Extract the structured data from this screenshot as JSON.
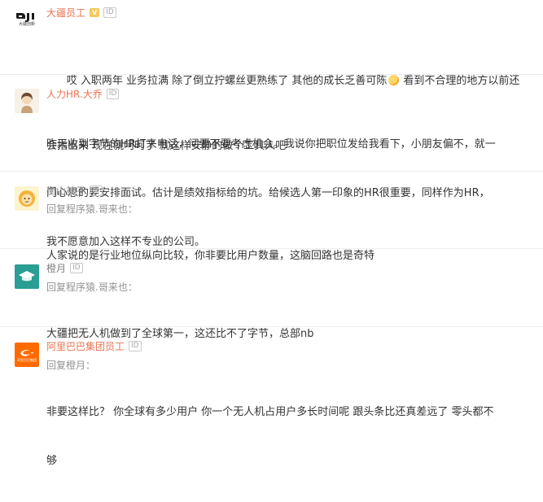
{
  "comments": [
    {
      "username": "大疆员工",
      "badge_v": "V",
      "badge_id": "ID",
      "avatar_text": "大疆创新",
      "lines": [
        "哎 入职两年 业务拉满 除了倒立拧螺丝更熟练了 其他的成长乏善可陈",
        "会指出来 现在就呵呵了 就这样安静的做个工具人吧"
      ],
      "line1_tail": "看到不合理的地方以前还"
    },
    {
      "username": "人力HR.大乔",
      "badge_id": "ID",
      "lines": [
        "昨天收到字节的HR打来电话，问要不要考虑机会。我说你把职位发给我看下，小朋友偏不，就一",
        "门心思的要安排面试。估计是绩效指标给的坑。给候选人第一印象的HR很重要，同样作为HR，",
        "我不愿意加入这样不专业的公司。"
      ]
    },
    {
      "username": "衡山弟子",
      "badge_id": "ID",
      "reply_to": "回复程序猿.哥来也：",
      "lines": [
        "人家说的是行业地位纵向比较，你非要比用户数量，这脑回路也是奇特"
      ]
    },
    {
      "username": "橙月",
      "badge_id": "ID",
      "reply_to": "回复程序猿.哥来也：",
      "lines": [
        "大疆把无人机做到了全球第一，这还比不了字节，总部nb"
      ]
    },
    {
      "username": "阿里巴巴集团员工",
      "badge_id": "ID",
      "avatar_text": "阿里巴巴集团",
      "reply_to": "回复橙月：",
      "lines": [
        "非要这样比？ 你全球有多少用户 你一个无人机占用户多长时间呢 跟头条比还真差远了 零头都不",
        "够"
      ]
    }
  ]
}
